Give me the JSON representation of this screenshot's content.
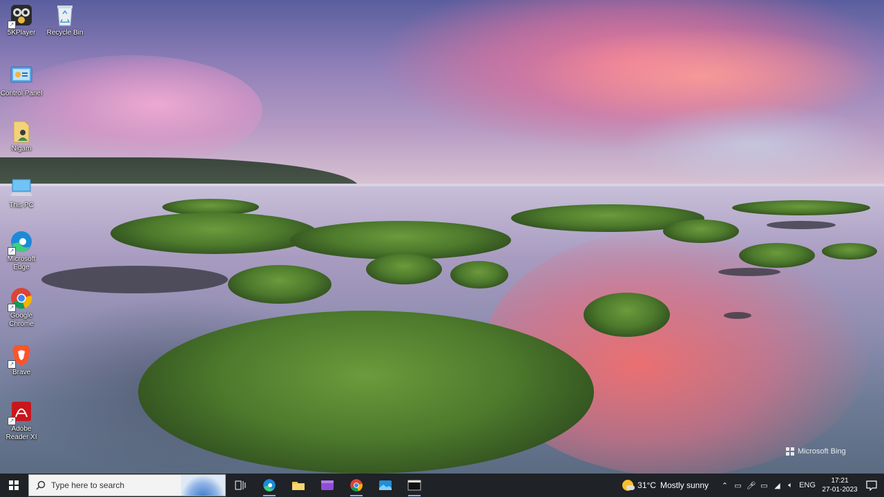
{
  "desktop": {
    "icons": [
      {
        "label": "5KPlayer",
        "icon": "5kplayer-icon"
      },
      {
        "label": "Recycle Bin",
        "icon": "recycle-bin-icon"
      },
      {
        "label": "Control Panel",
        "icon": "control-panel-icon"
      },
      {
        "label": "Nigam",
        "icon": "user-folder-icon"
      },
      {
        "label": "This PC",
        "icon": "this-pc-icon"
      },
      {
        "label": "Microsoft Edge",
        "icon": "edge-icon"
      },
      {
        "label": "Google Chrome",
        "icon": "chrome-icon"
      },
      {
        "label": "Brave",
        "icon": "brave-icon"
      },
      {
        "label": "Adobe Reader XI",
        "icon": "adobe-reader-icon"
      }
    ],
    "watermark": "Microsoft Bing"
  },
  "taskbar": {
    "search_placeholder": "Type here to search",
    "pinned": [
      "task-view-icon",
      "edge-icon",
      "file-explorer-icon",
      "app-icon",
      "chrome-icon",
      "photos-icon",
      "terminal-icon"
    ],
    "weather": {
      "temp": "31°C",
      "condition": "Mostly sunny"
    },
    "language": "ENG",
    "time": "17:21",
    "date": "27-01-2023"
  },
  "colors": {
    "taskbar": "#1f2226",
    "accent": "#7fb0f0"
  }
}
